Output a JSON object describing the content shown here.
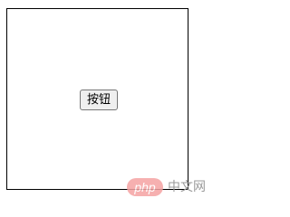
{
  "button": {
    "label": "按钮"
  },
  "watermark": {
    "logo_text": "php",
    "site_text": "中文网"
  },
  "colors": {
    "box_border": "#000000",
    "button_bg": "#efefef",
    "watermark_logo": "#f5a3a3"
  }
}
